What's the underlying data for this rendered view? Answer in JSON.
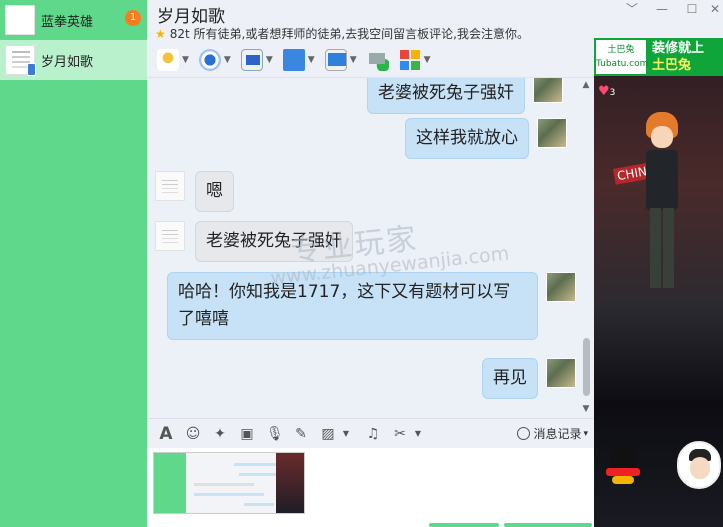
{
  "contacts": [
    {
      "name": "蓝拳英雄",
      "badge": "1"
    },
    {
      "name": "岁月如歌"
    }
  ],
  "header": {
    "title": "岁月如歌",
    "status": "82t 所有徒弟,或者想拜师的徒弟,去我空间留言板评论,我会注意你。",
    "window_controls": [
      "﹀",
      "—",
      "☐",
      "✕"
    ]
  },
  "messages": [
    {
      "from": "me",
      "text": "老婆被死兔子强奸"
    },
    {
      "from": "me",
      "text": "这样我就放心"
    },
    {
      "from": "other",
      "text": "嗯"
    },
    {
      "from": "other",
      "text": "老婆被死兔子强奸"
    },
    {
      "from": "me",
      "text": "哈哈！你知我是1717，这下又有题材可以写了嘻嘻"
    },
    {
      "from": "me",
      "text": "再见"
    }
  ],
  "watermark": {
    "line1": "专业玩家",
    "line2": "www.zhuanyewanjia.com"
  },
  "inputbar": {
    "history_label": "消息记录",
    "dropdown": "▾"
  },
  "ad": {
    "logo_text": "土巴兔\nTubatu.com",
    "line1": "装修就上",
    "line2": "土巴兔"
  },
  "show": {
    "scene_text": "CHINA",
    "heart_count": "3"
  },
  "colors": {
    "sidebar": "#5fd88c",
    "selected": "#b9f1cd",
    "bubble_me": "#c7e2f7",
    "bubble_other": "#e6e8eb",
    "ad_green": "#0fa53b"
  }
}
